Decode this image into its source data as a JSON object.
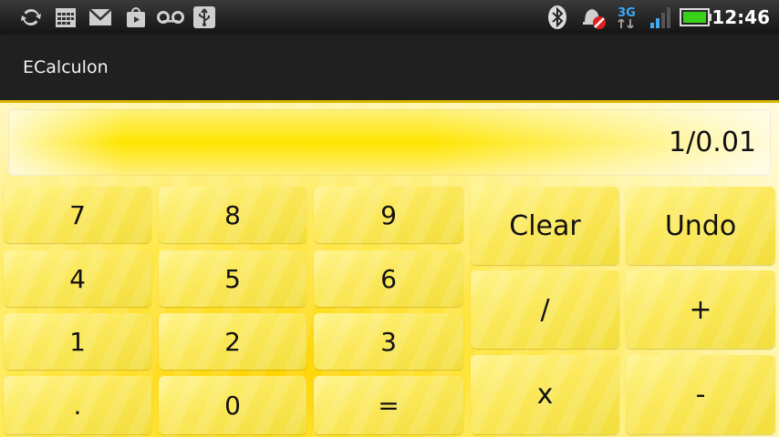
{
  "status_bar": {
    "time": "12:46",
    "network": "3G",
    "icons": [
      "sync-icon",
      "calendar-icon",
      "gmail-icon",
      "market-icon",
      "voicemail-icon",
      "usb-icon",
      "bluetooth-icon",
      "alarm-off-icon",
      "3g-icon",
      "signal-icon",
      "battery-icon"
    ]
  },
  "app": {
    "title": "ECalculon"
  },
  "display": {
    "value": "1/0.01"
  },
  "keys": {
    "k7": "7",
    "k8": "8",
    "k9": "9",
    "k4": "4",
    "k5": "5",
    "k6": "6",
    "k1": "1",
    "k2": "2",
    "k3": "3",
    "dot": ".",
    "k0": "0",
    "eq": "=",
    "clear": "Clear",
    "undo": "Undo",
    "div": "/",
    "plus": "+",
    "mul": "x",
    "minus": "-"
  },
  "colors": {
    "accent": "#ffe500",
    "titlebar": "#202020",
    "statusbar": "#222222"
  }
}
